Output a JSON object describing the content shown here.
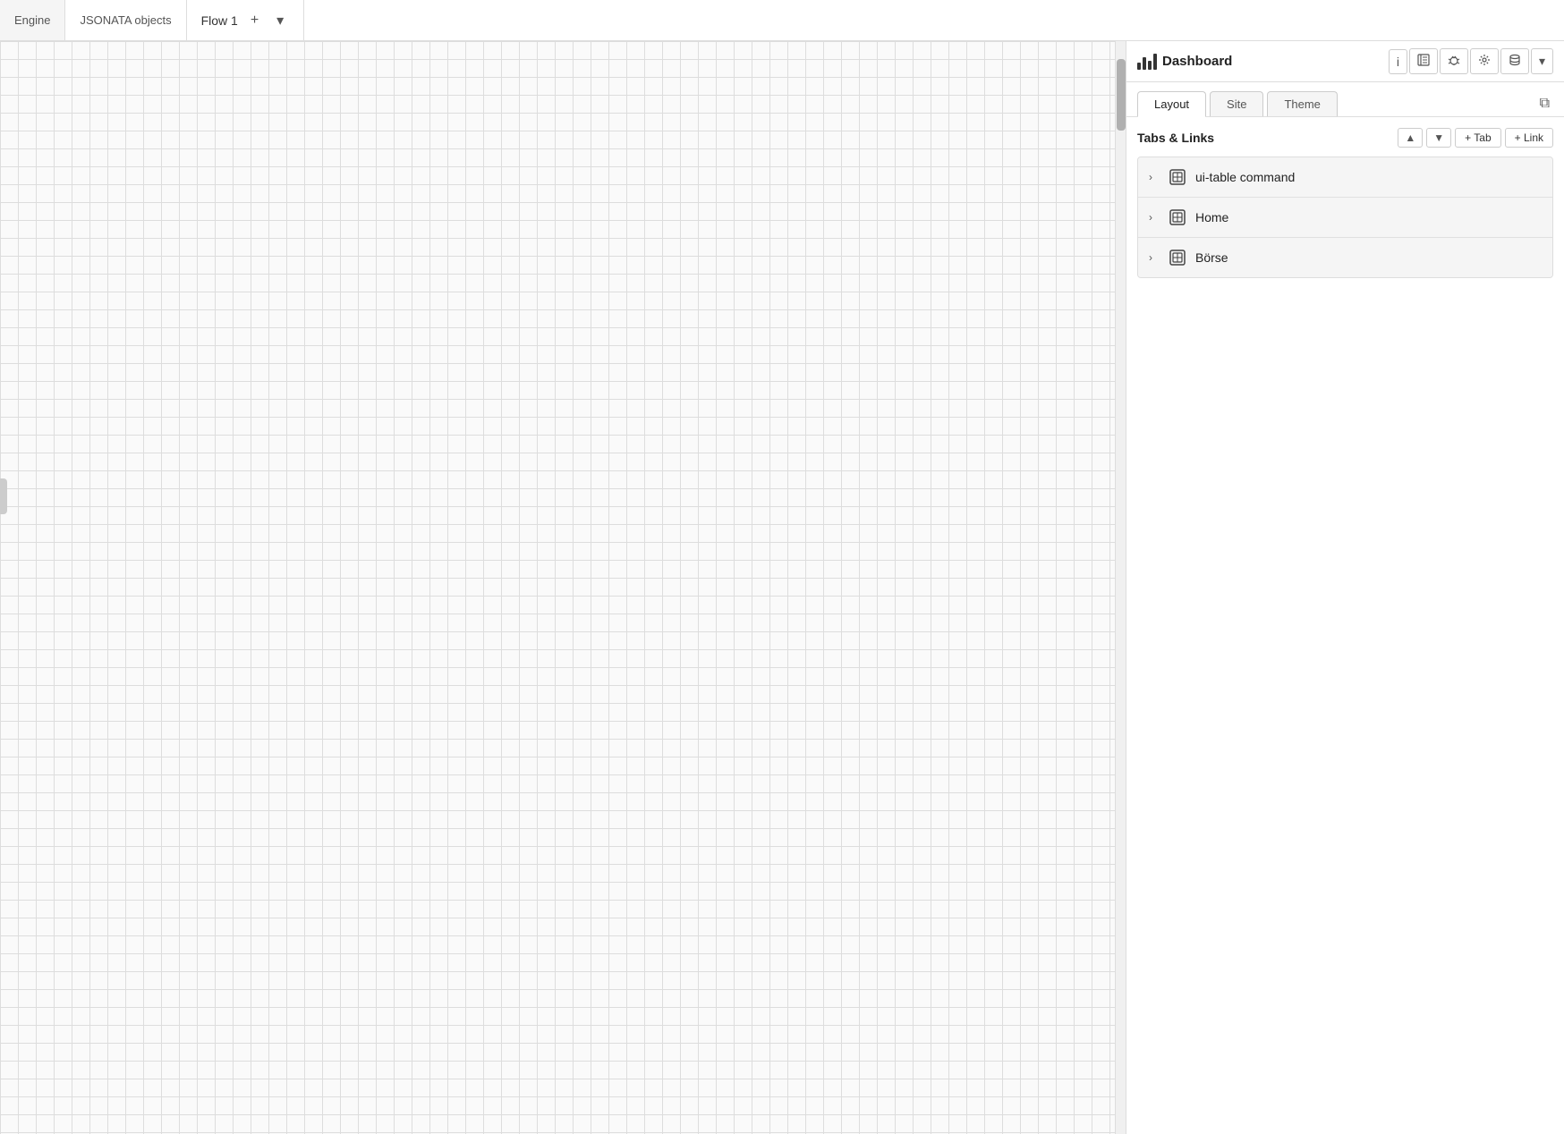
{
  "topbar": {
    "engine_tab": "Engine",
    "jsonata_tab": "JSONATA objects",
    "flow_tab": "Flow 1",
    "add_btn": "+",
    "dropdown_btn": "▾"
  },
  "panel": {
    "title": "Dashboard",
    "tabs": [
      "Layout",
      "Site",
      "Theme"
    ],
    "active_tab": "Layout",
    "external_link_title": "Open in new window",
    "section_title": "Tabs & Links",
    "arrow_up": "▲",
    "arrow_down": "▼",
    "add_tab": "+ Tab",
    "add_link": "+ Link",
    "tree_items": [
      {
        "label": "ui-table command"
      },
      {
        "label": "Home"
      },
      {
        "label": "Börse"
      }
    ]
  },
  "icons": {
    "info": "i",
    "book": "📋",
    "bug": "🐛",
    "settings": "⚙",
    "database": "🗄",
    "dropdown": "▾",
    "chevron_right": "›",
    "external_link": "⧉"
  }
}
